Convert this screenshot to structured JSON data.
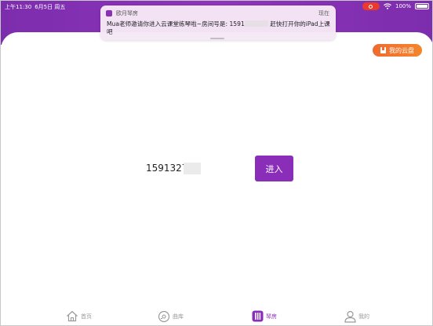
{
  "status_bar": {
    "time": "上午11:30",
    "date": "6月5日 周五",
    "battery": "100%"
  },
  "notification": {
    "app_name": "欧月琴房",
    "time": "现在",
    "message_prefix": "Mua老师邀请你进入云课堂练琴啦~房间号是: 1591",
    "message_suffix": "赶快打开你的iPad上课吧"
  },
  "cloud_disk": {
    "label": "我的云盘"
  },
  "room": {
    "number": "1591327",
    "enter_label": "进入"
  },
  "bottom_nav": {
    "items": [
      {
        "label": "首页",
        "icon": "home-icon"
      },
      {
        "label": "曲库",
        "icon": "music-disc-icon"
      },
      {
        "label": "琴房",
        "icon": "piano-icon"
      },
      {
        "label": "我的",
        "icon": "user-icon"
      }
    ]
  },
  "colors": {
    "primary": "#8a2db8",
    "header_purple": "#7c2dad",
    "cloud_orange": "#f06a31",
    "recording_red": "#e83b2c"
  }
}
